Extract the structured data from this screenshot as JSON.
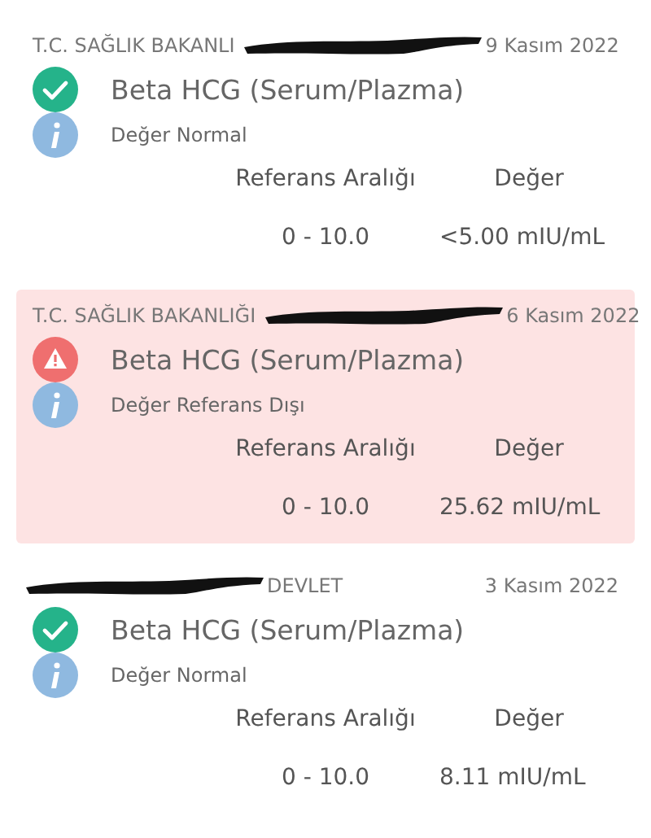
{
  "results": [
    {
      "kind": "normal",
      "source_start": "T.C. SAĞLIK BAKANLI",
      "date": "9 Kasım 2022",
      "test": "Beta HCG (Serum/Plazma)",
      "note": "Değer Normal",
      "range_label": "Referans Aralığı",
      "value_label": "Değer",
      "range": "0 - 10.0",
      "value": "<5.00 mIU/mL"
    },
    {
      "kind": "abnormal",
      "source_start": "T.C. SAĞLIK BAKANLIĞI",
      "date": "6 Kasım 2022",
      "test": "Beta HCG (Serum/Plazma)",
      "note": "Değer Referans Dışı",
      "range_label": "Referans Aralığı",
      "value_label": "Değer",
      "range": "0 - 10.0",
      "value": "25.62 mIU/mL"
    },
    {
      "kind": "normal",
      "source_end": "DEVLET",
      "date": "3 Kasım 2022",
      "test": "Beta HCG (Serum/Plazma)",
      "note": "Değer Normal",
      "range_label": "Referans Aralığı",
      "value_label": "Değer",
      "range": "0 - 10.0",
      "value": "8.11 mIU/mL"
    }
  ]
}
